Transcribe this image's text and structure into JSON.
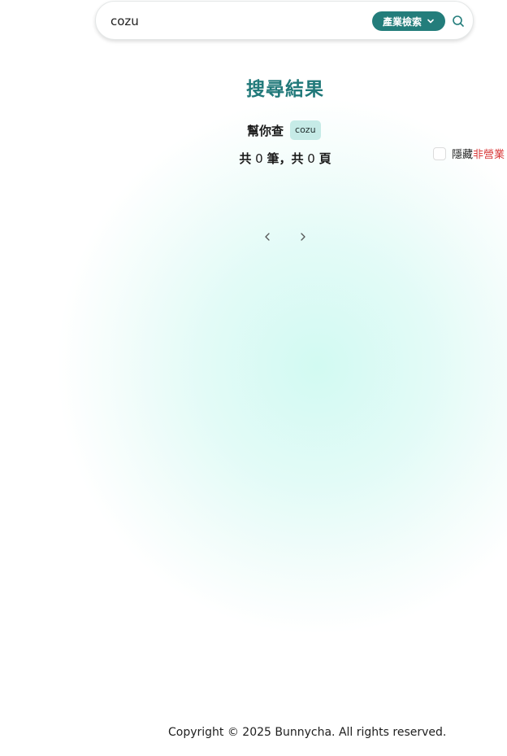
{
  "search": {
    "value": "cozu",
    "category_label": "產業檢索"
  },
  "results": {
    "title": "搜尋結果",
    "query_label": "幫你查",
    "query_term": "cozu",
    "count_prefix": "共",
    "total_count": "0",
    "count_unit": "筆，共",
    "page_count": "0",
    "page_unit": "頁"
  },
  "filter": {
    "hide_prefix": "隱藏",
    "hide_highlight": "非營業"
  },
  "footer": {
    "copyright": "Copyright © 2025 Bunnycha. All rights reserved."
  },
  "colors": {
    "accent": "#237d7b",
    "title": "#21797a",
    "chip_bg": "#c6ebe7",
    "highlight_red": "#d93a3a"
  },
  "icons": {
    "category_dropdown": "chevron-down-icon",
    "search": "search-icon",
    "prev_page": "chevron-left-icon",
    "next_page": "chevron-right-icon"
  }
}
